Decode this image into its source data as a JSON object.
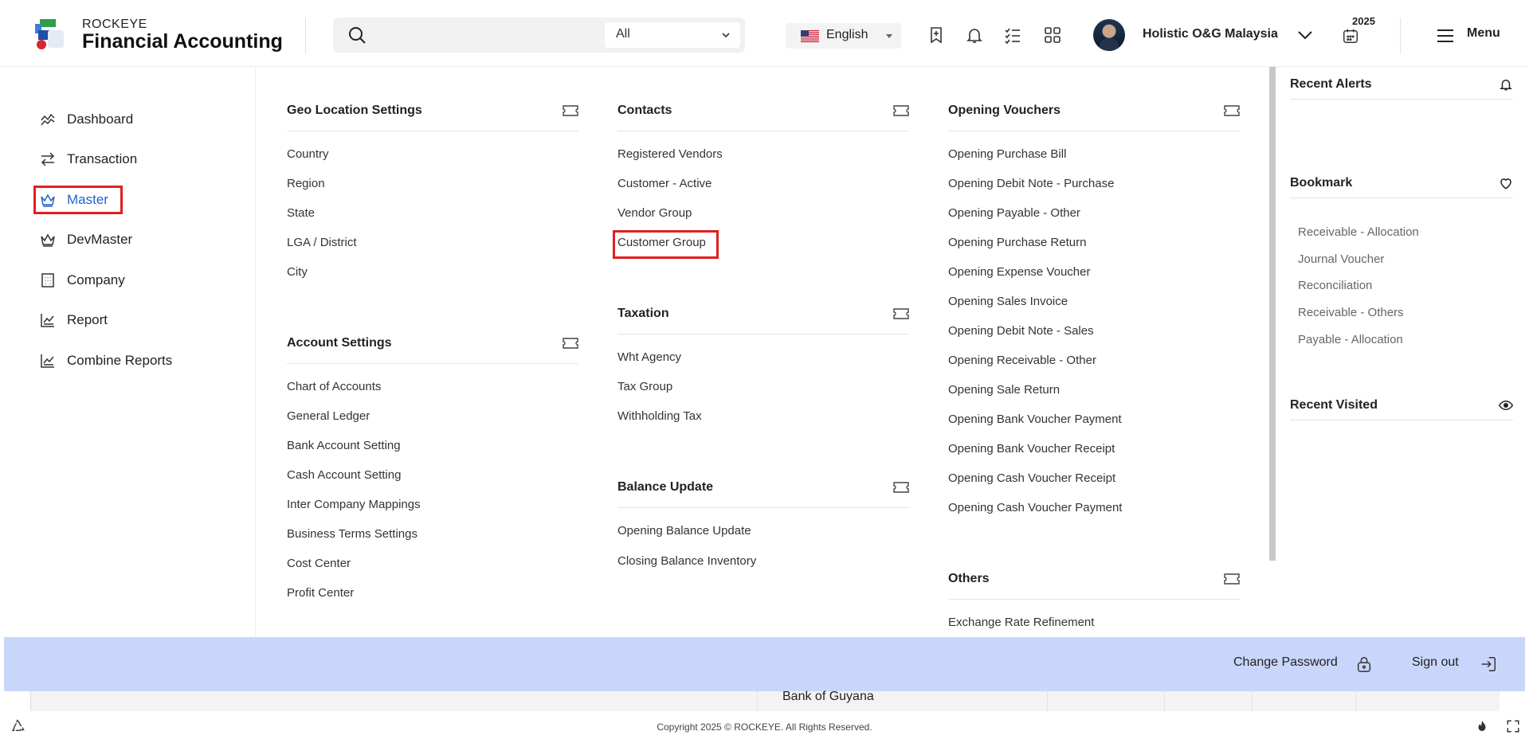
{
  "header": {
    "brand_top": "ROCKEYE",
    "brand_main": "Financial Accounting",
    "search_placeholder": "",
    "search_scope": "All",
    "language": "English",
    "company": "Holistic O&G Malaysia",
    "year": "2025",
    "menu_label": "Menu"
  },
  "left_nav": [
    {
      "label": "Dashboard",
      "icon": "chart-line-icon"
    },
    {
      "label": "Transaction",
      "icon": "arrows-swap-icon"
    },
    {
      "label": "Master",
      "icon": "crown-icon",
      "active": true
    },
    {
      "label": "DevMaster",
      "icon": "crown-icon"
    },
    {
      "label": "Company",
      "icon": "building-icon"
    },
    {
      "label": "Report",
      "icon": "report-chart-icon"
    },
    {
      "label": "Combine Reports",
      "icon": "report-chart-icon"
    }
  ],
  "mega": {
    "geo": {
      "title": "Geo Location Settings",
      "items": [
        "Country",
        "Region",
        "State",
        "LGA / District",
        "City"
      ]
    },
    "account": {
      "title": "Account Settings",
      "items": [
        "Chart of Accounts",
        "General Ledger",
        "Bank Account Setting",
        "Cash Account Setting",
        "Inter Company Mappings",
        "Business Terms Settings",
        "Cost Center",
        "Profit Center"
      ]
    },
    "contacts": {
      "title": "Contacts",
      "items": [
        "Registered Vendors",
        "Customer - Active",
        "Vendor Group",
        "Customer Group"
      ]
    },
    "taxation": {
      "title": "Taxation",
      "items": [
        "Wht Agency",
        "Tax Group",
        "Withholding Tax"
      ]
    },
    "balance": {
      "title": "Balance Update",
      "items": [
        "Opening Balance Update",
        "Closing Balance Inventory"
      ]
    },
    "opening": {
      "title": "Opening Vouchers",
      "items": [
        "Opening Purchase Bill",
        "Opening Debit Note - Purchase",
        "Opening Payable - Other",
        "Opening Purchase Return",
        "Opening Expense Voucher",
        "Opening Sales Invoice",
        "Opening Debit Note - Sales",
        "Opening Receivable - Other",
        "Opening Sale Return",
        "Opening Bank Voucher Payment",
        "Opening Bank Voucher Receipt",
        "Opening Cash Voucher Receipt",
        "Opening Cash Voucher Payment"
      ]
    },
    "others": {
      "title": "Others",
      "items": [
        "Exchange Rate Refinement"
      ]
    }
  },
  "right_panel": {
    "alerts_title": "Recent Alerts",
    "bookmark_title": "Bookmark",
    "bookmarks": [
      "Receivable - Allocation",
      "Journal Voucher",
      "Reconciliation",
      "Receivable - Others",
      "Payable - Allocation"
    ],
    "visited_title": "Recent Visited"
  },
  "footer": {
    "change_password": "Change Password",
    "sign_out": "Sign out",
    "behind_row": "Bank of Guyana",
    "copyright": "Copyright 2025 © ROCKEYE. All Rights Reserved."
  },
  "colors": {
    "accent": "#2463c9",
    "highlight": "#e0201d",
    "footer_bg": "#c9d6fb"
  }
}
